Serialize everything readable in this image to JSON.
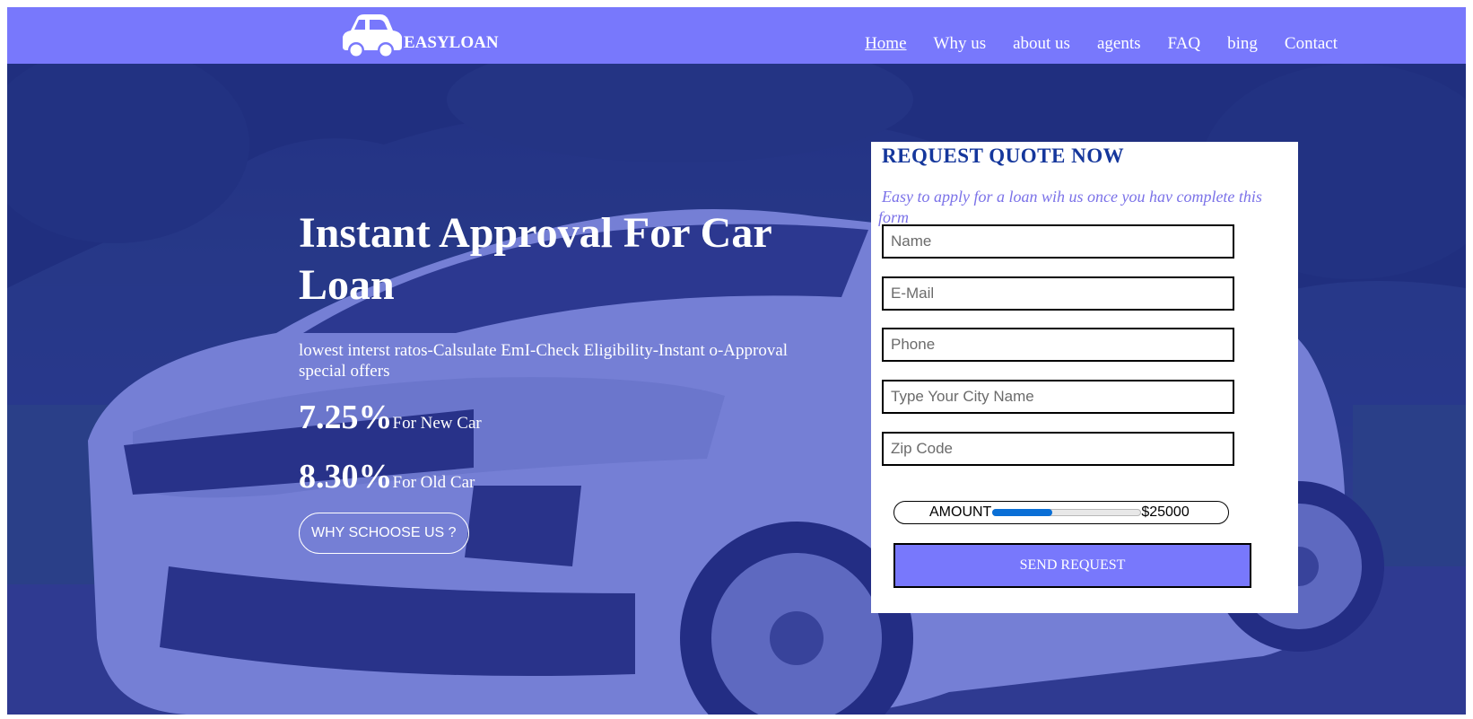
{
  "brand": {
    "name": "EASYLOAN",
    "logo_icon": "car-icon"
  },
  "nav": {
    "items": [
      {
        "label": "Home",
        "active": true
      },
      {
        "label": "Why us",
        "active": false
      },
      {
        "label": "about us",
        "active": false
      },
      {
        "label": "agents",
        "active": false
      },
      {
        "label": "FAQ",
        "active": false
      },
      {
        "label": "bing",
        "active": false
      },
      {
        "label": "Contact",
        "active": false
      }
    ]
  },
  "hero": {
    "title": "Instant Approval For Car Loan",
    "subtitle": "lowest interst ratos-Calsulate EmI-Check Eligibility-Instant o-Approval special offers",
    "rates": [
      {
        "value": "7.25%",
        "label": "For New Car"
      },
      {
        "value": "8.30%",
        "label": "For Old Car"
      }
    ],
    "cta_label": "WHY SCHOOSE US ?"
  },
  "quote_form": {
    "title": "REQUEST QUOTE NOW",
    "description": "Easy to apply for a loan wih us once you hav complete this form",
    "fields": {
      "name": {
        "placeholder": "Name",
        "value": ""
      },
      "email": {
        "placeholder": "E-Mail",
        "value": ""
      },
      "phone": {
        "placeholder": "Phone",
        "value": ""
      },
      "city": {
        "placeholder": "Type Your City Name",
        "value": ""
      },
      "zip": {
        "placeholder": "Zip Code",
        "value": ""
      }
    },
    "amount": {
      "label": "AMOUNT",
      "value_text": "$25000",
      "slider_fraction": 0.4
    },
    "submit_label": "SEND REQUEST"
  },
  "colors": {
    "nav_bg": "#7878fc",
    "form_title": "#15379c",
    "form_desc": "#7b72e8",
    "button_bg": "#7878fc",
    "slider_fill": "#0a6fd6",
    "hero_tint": "rgba(40,55,200,0.58)"
  }
}
